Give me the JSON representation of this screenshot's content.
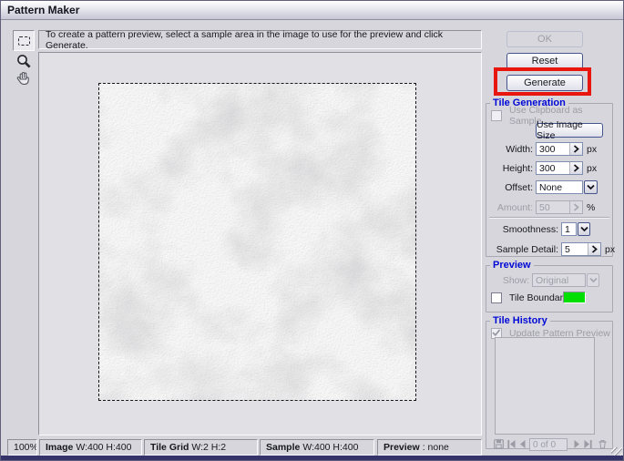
{
  "window": {
    "title": "Pattern Maker"
  },
  "instruction_text": "To create a pattern preview, select a sample area in the image to use for the preview and click Generate.",
  "icons": {
    "tools": [
      "rectangular-marquee-icon",
      "zoom-icon",
      "hand-icon"
    ],
    "history_nav": [
      "save-preset-icon",
      "first-tile-icon",
      "previous-tile-icon",
      "next-tile-icon",
      "last-tile-icon",
      "delete-tile-icon"
    ]
  },
  "buttons": {
    "ok": "OK",
    "reset": "Reset",
    "generate": "Generate",
    "use_image_size": "Use Image Size"
  },
  "tile_generation": {
    "title": "Tile Generation",
    "use_clipboard_label": "Use Clipboard as Sample",
    "width_label": "Width:",
    "width_value": "300",
    "width_unit": "px",
    "height_label": "Height:",
    "height_value": "300",
    "height_unit": "px",
    "offset_label": "Offset:",
    "offset_value": "None",
    "amount_label": "Amount:",
    "amount_value": "50",
    "amount_unit": "%",
    "smoothness_label": "Smoothness:",
    "smoothness_value": "1",
    "sample_detail_label": "Sample Detail:",
    "sample_detail_value": "5",
    "sample_detail_unit": "px"
  },
  "preview": {
    "title": "Preview",
    "show_label": "Show:",
    "show_value": "Original",
    "tile_boundaries_label": "Tile Boundaries",
    "boundary_color": "#00DF00"
  },
  "tile_history": {
    "title": "Tile History",
    "update_preview_label": "Update Pattern Preview",
    "counter": "0 of 0"
  },
  "status_bar": {
    "zoom_level": "100%",
    "image_label": "Image",
    "image_value": "W:400 H:400",
    "tile_grid_label": "Tile Grid",
    "tile_grid_value": "W:2 H:2",
    "sample_label": "Sample",
    "sample_value": "W:400 H:400",
    "preview_label": "Preview",
    "preview_value": ": none"
  },
  "annotation": {
    "highlight_color": "#E8160C"
  }
}
